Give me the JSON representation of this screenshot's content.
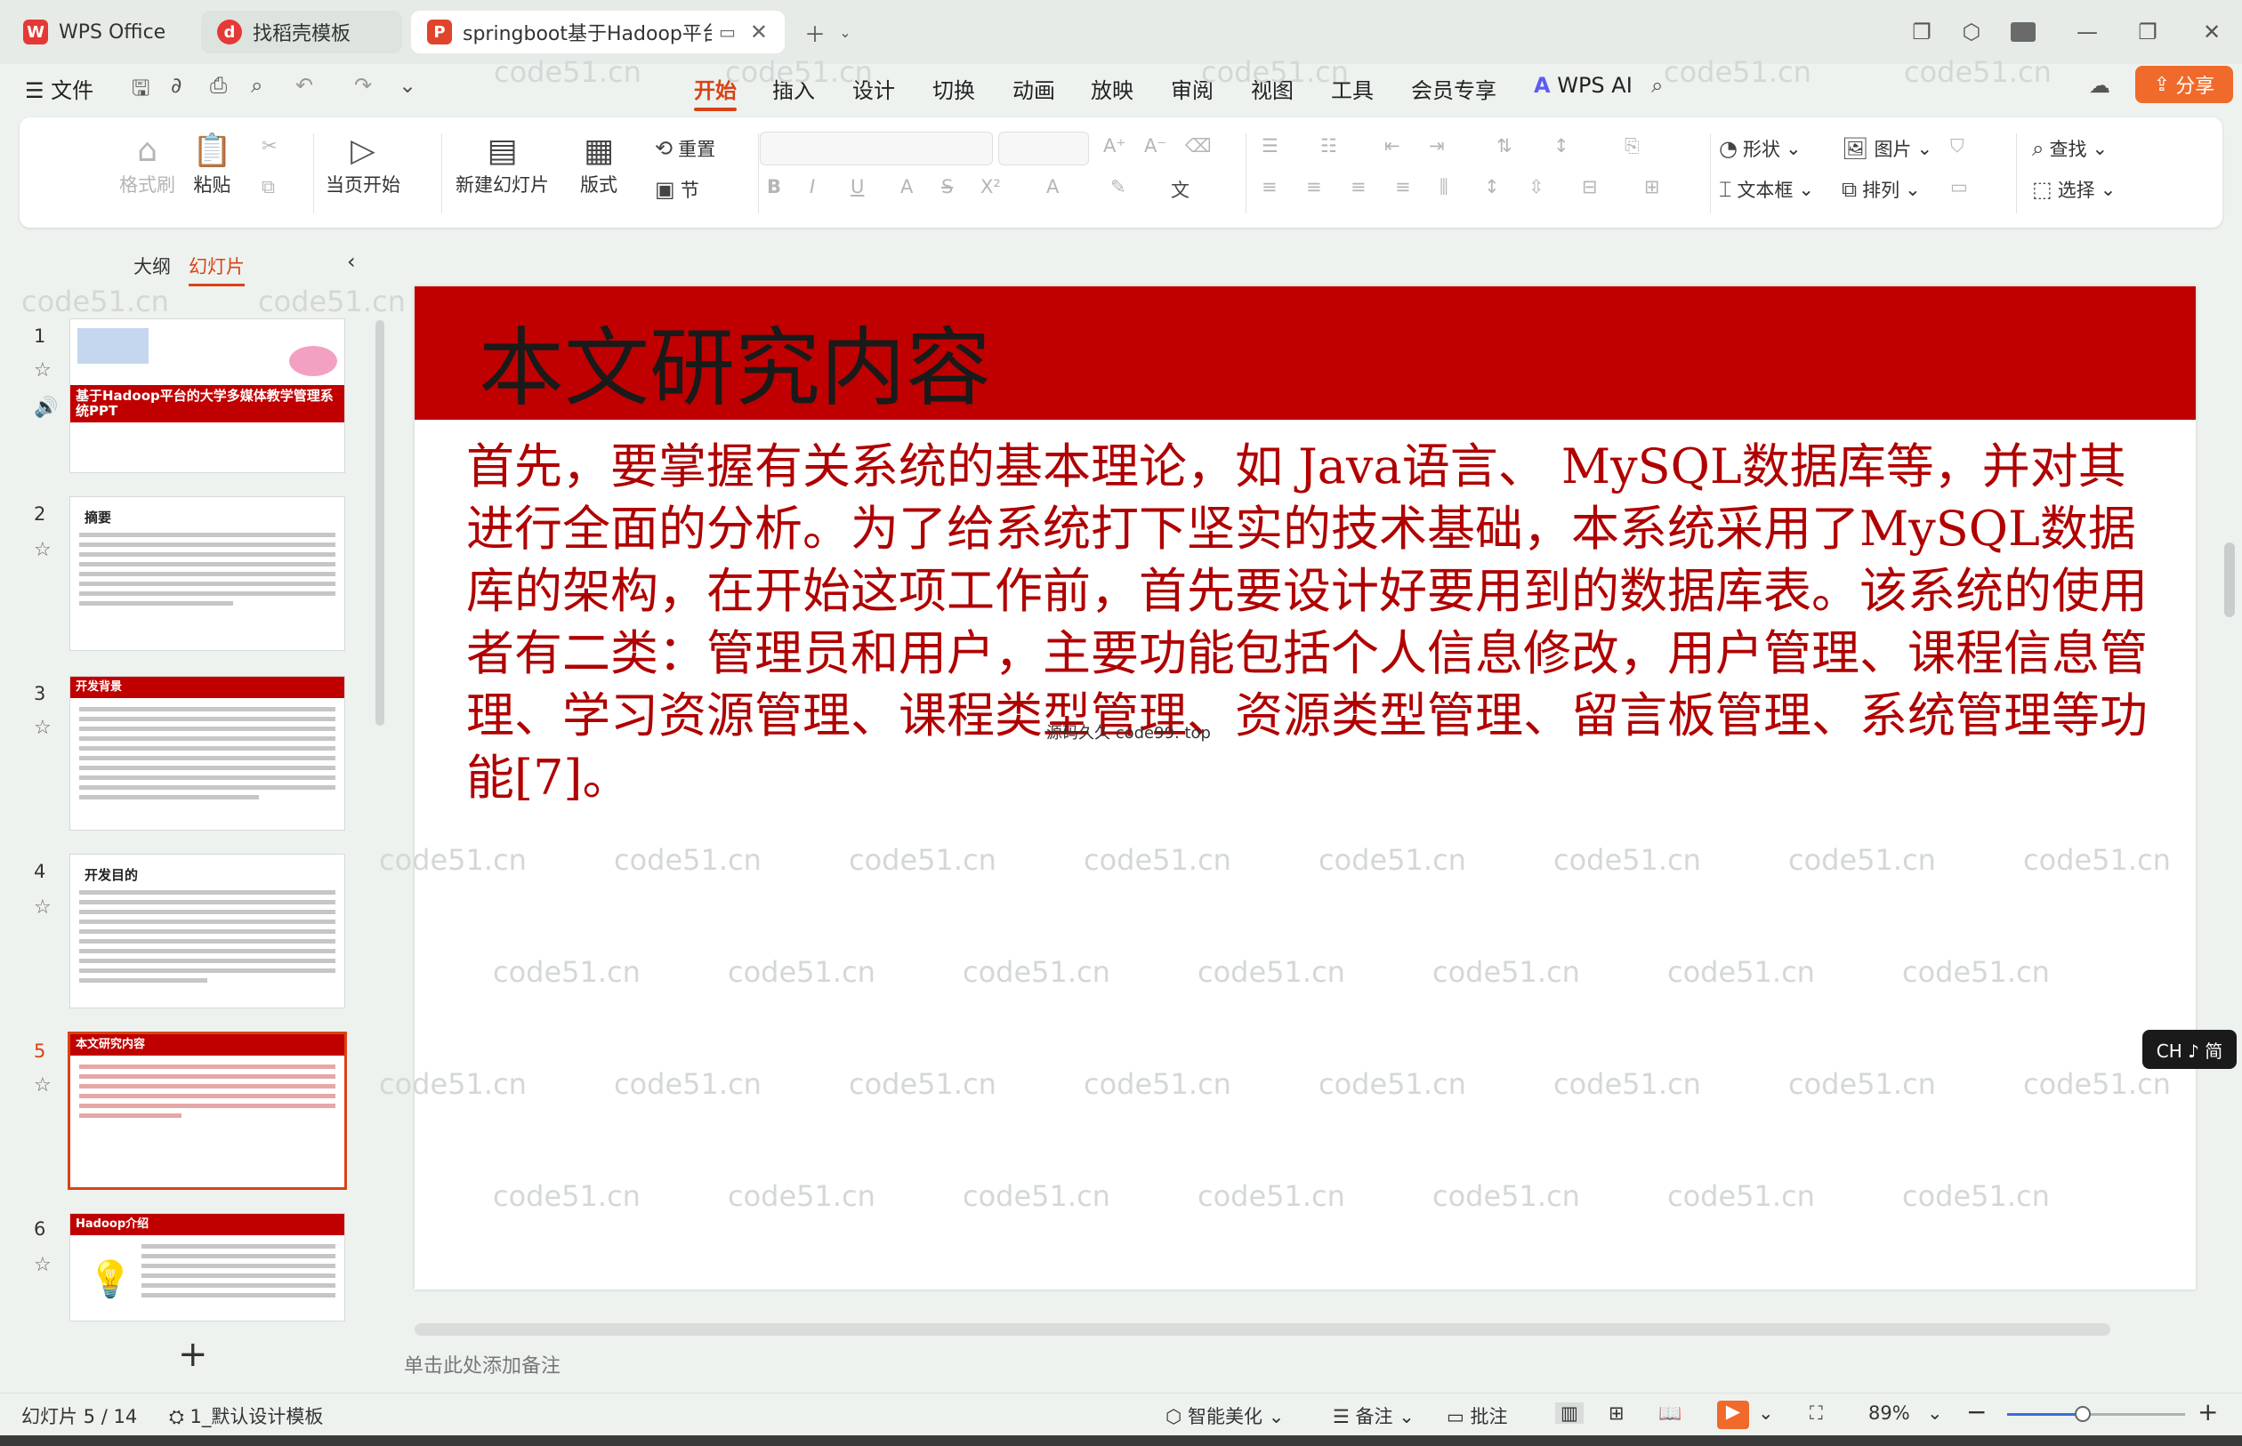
{
  "tabs": {
    "wps_office": "WPS Office",
    "template": "找稻壳模板",
    "document": "springboot基于Hadoop平台的"
  },
  "menu": {
    "file": "文件",
    "items": [
      "开始",
      "插入",
      "设计",
      "切换",
      "动画",
      "放映",
      "审阅",
      "视图",
      "工具",
      "会员专享"
    ],
    "wps_ai": "WPS AI",
    "share": "分享"
  },
  "ribbon": {
    "format_painter": "格式刷",
    "paste": "粘贴",
    "from_current": "当页开始",
    "new_slide": "新建幻灯片",
    "layout": "版式",
    "reset": "重置",
    "section": "节",
    "shape": "形状",
    "picture": "图片",
    "find": "查找",
    "textbox": "文本框",
    "arrange": "排列",
    "select": "选择"
  },
  "panel": {
    "outline_tab": "大纲",
    "slides_tab": "幻灯片",
    "thumbnails": [
      {
        "num": "1",
        "title": "基于Hadoop平台的大学多媒体教学管理系统PPT"
      },
      {
        "num": "2",
        "title": "摘要"
      },
      {
        "num": "3",
        "title": "开发背景"
      },
      {
        "num": "4",
        "title": "开发目的"
      },
      {
        "num": "5",
        "title": "本文研究内容"
      },
      {
        "num": "6",
        "title": "Hadoop介绍"
      }
    ],
    "add": "+"
  },
  "slide": {
    "title": "本文研究内容",
    "body": "首先，要掌握有关系统的基本理论，如 Java语言、 MySQL数据库等，并对其进行全面的分析。为了给系统打下坚实的技术基础，本系统采用了MySQL数据库的架构，在开始这项工作前，首先要设计好要用到的数据库表。该系统的使用者有二类：管理员和用户，主要功能包括个人信息修改，用户管理、课程信息管理、学习资源管理、课程类型管理、资源类型管理、留言板管理、系统管理等功能[7]。",
    "small_text": "源码久久 code99. top",
    "watermark": "code51.cn"
  },
  "notes_placeholder": "单击此处添加备注",
  "ime": "CH ♪ 简",
  "status": {
    "slide_counter": "幻灯片 5 / 14",
    "theme": "1_默认设计模板",
    "beautify": "智能美化",
    "notes": "备注",
    "comments": "批注",
    "zoom": "89%"
  },
  "colors": {
    "accent": "#d84315",
    "slide_header": "#c00000",
    "body_text": "#b00000"
  }
}
